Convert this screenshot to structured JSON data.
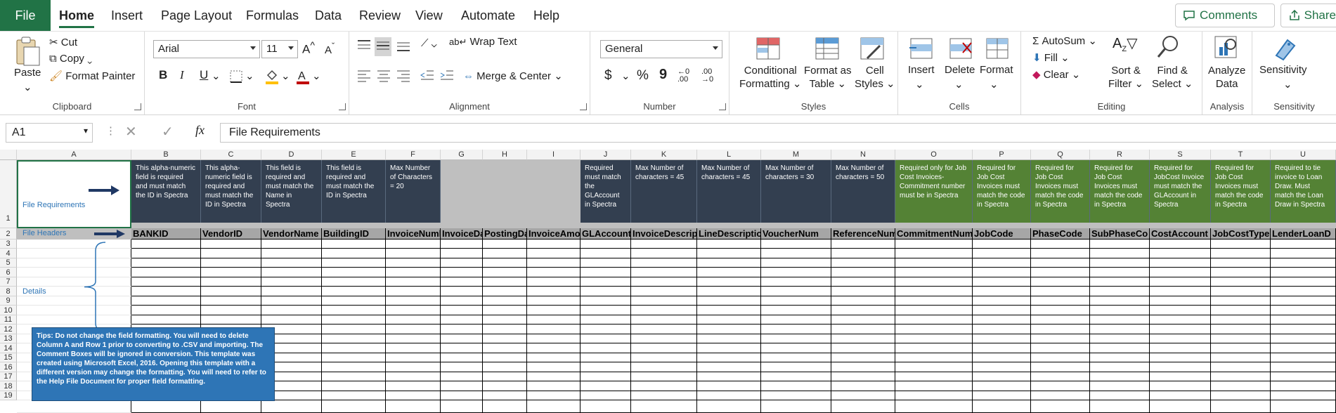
{
  "tabs": {
    "file": "File",
    "items": [
      "Home",
      "Insert",
      "Page Layout",
      "Formulas",
      "Data",
      "Review",
      "View",
      "Automate",
      "Help"
    ],
    "comments": "Comments",
    "share": "Share"
  },
  "ribbon": {
    "clipboard": {
      "paste": "Paste",
      "cut": "Cut",
      "copy": "Copy",
      "format_painter": "Format Painter",
      "label": "Clipboard"
    },
    "font": {
      "name": "Arial",
      "size": "11",
      "bold": "B",
      "italic": "I",
      "underline": "U",
      "label": "Font"
    },
    "alignment": {
      "wrap": "Wrap Text",
      "merge": "Merge & Center",
      "label": "Alignment"
    },
    "number": {
      "format": "General",
      "currency": "$",
      "percent": "%",
      "comma": "9",
      "inc": ".00",
      "label": "Number"
    },
    "styles": {
      "conditional": [
        "Conditional",
        "Formatting"
      ],
      "format_table": [
        "Format as",
        "Table"
      ],
      "cell_styles": [
        "Cell",
        "Styles"
      ],
      "label": "Styles"
    },
    "cells": {
      "insert": "Insert",
      "delete": "Delete",
      "format": "Format",
      "label": "Cells"
    },
    "editing": {
      "autosum": "AutoSum",
      "fill": "Fill",
      "clear": "Clear",
      "sort": [
        "Sort &",
        "Filter"
      ],
      "find": [
        "Find &",
        "Select"
      ],
      "label": "Editing"
    },
    "analysis": {
      "analyze": [
        "Analyze",
        "Data"
      ],
      "label": "Analysis"
    },
    "sensitivity": {
      "button": "Sensitivity",
      "label": "Sensitivity"
    }
  },
  "formula_bar": {
    "name_box": "A1",
    "fx": "fx",
    "content": "File Requirements"
  },
  "sheet": {
    "row1_label": "File Requirements",
    "row2_label": "File Headers",
    "details_label": "Details",
    "row_numbers": [
      "1",
      "2",
      "3",
      "4",
      "5",
      "6",
      "7",
      "8",
      "9",
      "10",
      "11",
      "12",
      "13",
      "14",
      "15",
      "16",
      "17",
      "18",
      "19"
    ],
    "columns": [
      "A",
      "B",
      "C",
      "D",
      "E",
      "F",
      "G",
      "H",
      "I",
      "J",
      "K",
      "L",
      "M",
      "N",
      "O",
      "P",
      "Q",
      "R",
      "S",
      "T",
      "U"
    ],
    "headers": [
      "BANKID",
      "VendorID",
      "VendorName",
      "BuildingID",
      "InvoiceNuml",
      "InvoiceDa",
      "PostingDa",
      "InvoiceAmou",
      "GLAccount",
      "InvoiceDescrip",
      "LineDescription",
      "VoucherNum",
      "ReferenceNum",
      "CommitmentNum",
      "JobCode",
      "PhaseCode",
      "SubPhaseCo",
      "CostAccount",
      "JobCostType",
      "LenderLoanD"
    ],
    "requirements": [
      "This alpha-numeric field is required and must match the ID in Spectra",
      "This alpha-numeric field is required and must match the ID in Spectra",
      "This field is required and must match the Name in Spectra",
      "This field is required and must match the ID in Spectra",
      "Max Number of Characters = 20",
      "",
      "",
      "",
      "Required must match the GLAccount in Spectra",
      "Max Number of characters = 45",
      "Max Number of characters = 45",
      "Max Number of characters = 30",
      "Max Number of characters = 50",
      "Required only for Job Cost Invoices-Commitment number must be in Spectra",
      "Required for Job Cost Invoices must match the code in Spectra",
      "Required for Job Cost Invoices must match the code in Spectra",
      "Required for Job Cost Invoices must match the code in Spectra",
      "Required for JobCost Invoice must match the GLAccount in Spectra",
      "Required for Job Cost Invoices must match the code in Spectra",
      "Required to tie invoice to Loan Draw. Must match the Loan Draw in Spectra"
    ],
    "tips": "Tips:  Do not change the field formatting.  You will need to delete Column A and Row 1 prior to converting to .CSV and importing.  The Comment Boxes will be ignored in conversion.  This template was created using Microsoft Excel, 2016.  Opening this template with a different version may change the formatting.  You will need to refer to the Help File Document for proper field formatting.",
    "colors": {
      "dark": "#333f50",
      "green": "#548235",
      "gray": "#bfbfbf",
      "header_gray": "#a6a6a6",
      "tips_blue": "#2e75b6"
    }
  }
}
